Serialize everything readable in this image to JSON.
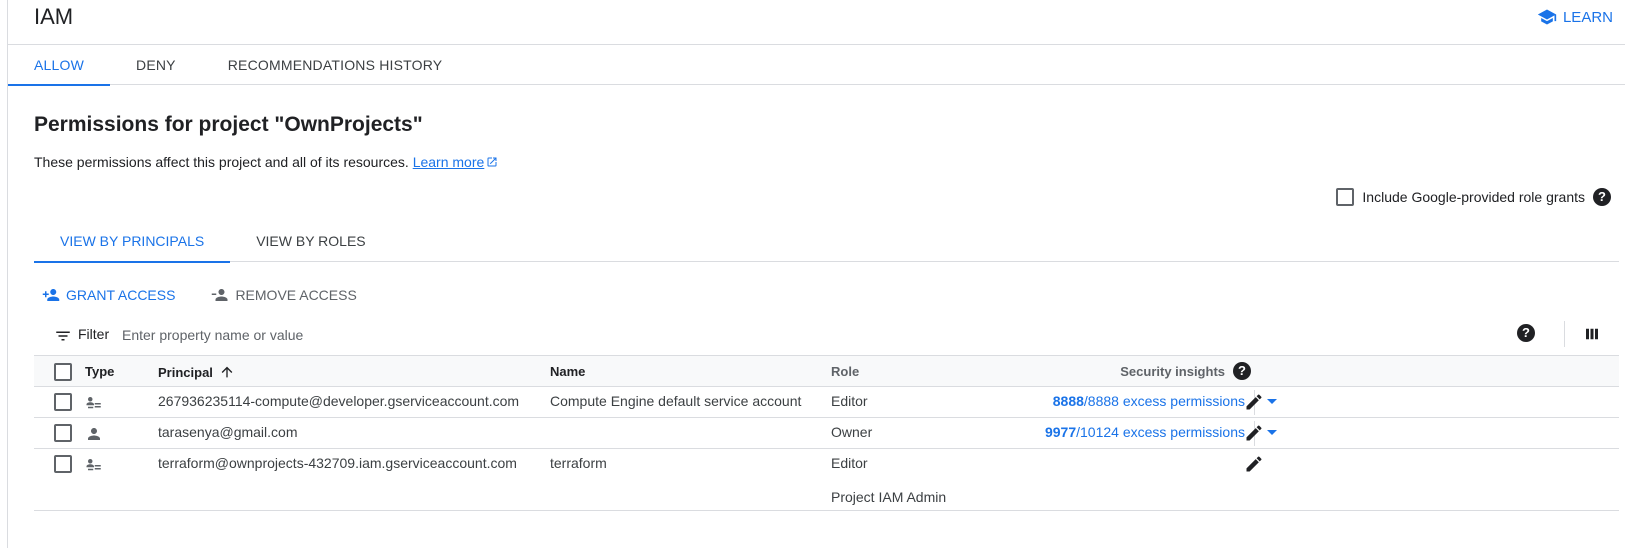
{
  "header": {
    "title": "IAM",
    "learn_label": "LEARN"
  },
  "top_tabs": [
    {
      "label": "ALLOW",
      "active": true
    },
    {
      "label": "DENY",
      "active": false
    },
    {
      "label": "RECOMMENDATIONS HISTORY",
      "active": false
    }
  ],
  "page": {
    "title": "Permissions for project \"OwnProjects\"",
    "description": "These permissions affect this project and all of its resources.",
    "learn_more": "Learn more",
    "include_google_label": "Include Google-provided role grants"
  },
  "sub_tabs": [
    {
      "label": "VIEW BY PRINCIPALS",
      "active": true
    },
    {
      "label": "VIEW BY ROLES",
      "active": false
    }
  ],
  "actions": {
    "grant_label": "GRANT ACCESS",
    "remove_label": "REMOVE ACCESS"
  },
  "filter": {
    "label": "Filter",
    "placeholder": "Enter property name or value"
  },
  "table": {
    "headers": {
      "type": "Type",
      "principal": "Principal",
      "name": "Name",
      "role": "Role",
      "security": "Security insights"
    },
    "rows": [
      {
        "type_icon": "service-account-icon",
        "principal": "267936235114-compute@developer.gserviceaccount.com",
        "name": "Compute Engine default service account",
        "role": "Editor",
        "sec_count": "8888",
        "sec_rest": "/8888 excess permissions"
      },
      {
        "type_icon": "person-icon",
        "principal": "tarasenya@gmail.com",
        "name": "",
        "role": "Owner",
        "sec_count": "9977",
        "sec_rest": "/10124 excess permissions"
      },
      {
        "type_icon": "service-account-icon",
        "principal": "terraform@ownprojects-432709.iam.gserviceaccount.com",
        "name": "terraform",
        "role": "Editor",
        "role2": "Project IAM Admin"
      }
    ]
  },
  "colors": {
    "accent": "#1a73e8",
    "text": "#202124",
    "muted": "#5f6368",
    "border": "#dadce0"
  }
}
